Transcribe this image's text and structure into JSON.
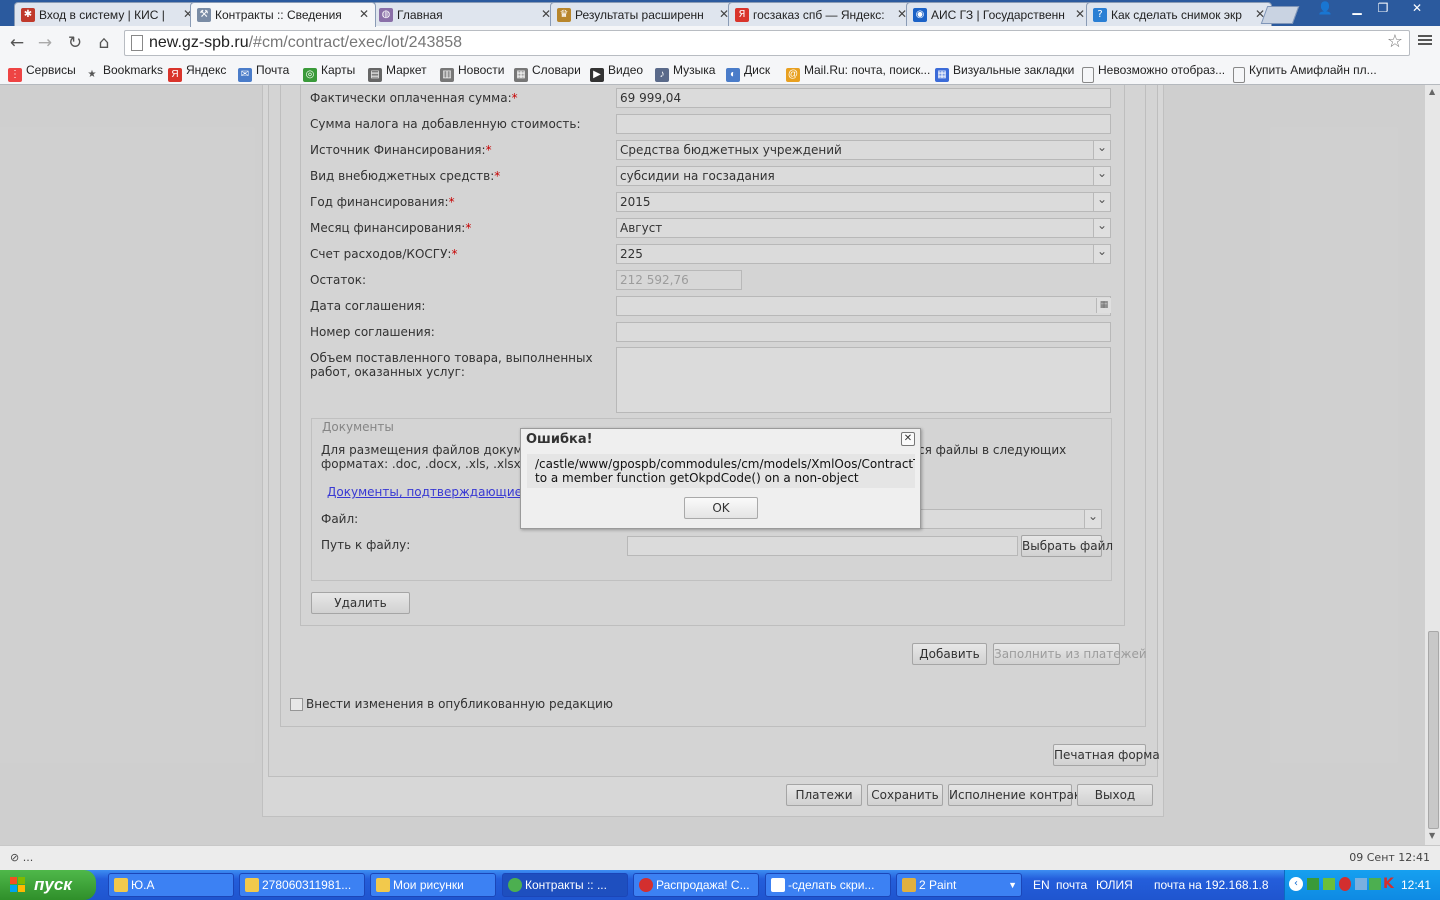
{
  "browser": {
    "tabs": [
      {
        "title": "Вход в систему | КИС |",
        "icon_color": "#c0392b"
      },
      {
        "title": "Контракты :: Сведения",
        "icon_color": "#7a8ca5"
      },
      {
        "title": "Главная",
        "icon_color": "#8a6fa8"
      },
      {
        "title": "Результаты расширенн",
        "icon_color": "#b8862b"
      },
      {
        "title": "госзаказ спб — Яндекс:",
        "icon_color": "#d9342b"
      },
      {
        "title": "АИС ГЗ | Государственн",
        "icon_color": "#1b62c7"
      },
      {
        "title": "Как сделать снимок экр",
        "icon_color": "#2a7fd4"
      }
    ],
    "url_host": "new.gz-spb.ru",
    "url_path": "/#cm/contract/exec/lot/243858",
    "bookmarks": [
      "Сервисы",
      "Bookmarks",
      "Яндекс",
      "Почта",
      "Карты",
      "Маркет",
      "Новости",
      "Словари",
      "Видео",
      "Музыка",
      "Диск",
      "Mail.Ru: почта, поиск...",
      "Визуальные закладки",
      "Невозможно отобраз...",
      "Купить Амифлайн пл..."
    ]
  },
  "form": {
    "rows": [
      {
        "label": "Фактически оплаченная сумма:",
        "required": true,
        "value": "69 999,04",
        "type": "text"
      },
      {
        "label": "Сумма налога на добавленную стоимость:",
        "required": false,
        "value": "",
        "type": "text"
      },
      {
        "label": "Источник Финансирования:",
        "required": true,
        "value": "Средства бюджетных учреждений",
        "type": "select"
      },
      {
        "label": "Вид внебюджетных средств:",
        "required": true,
        "value": "субсидии на госзадания",
        "type": "select"
      },
      {
        "label": "Год финансирования:",
        "required": true,
        "value": "2015",
        "type": "select"
      },
      {
        "label": "Месяц финансирования:",
        "required": true,
        "value": "Август",
        "type": "select"
      },
      {
        "label": "Счет расходов/КОСГУ:",
        "required": true,
        "value": "225",
        "type": "select"
      },
      {
        "label": "Остаток:",
        "required": false,
        "value": "212 592,76",
        "type": "readonly"
      },
      {
        "label": "Дата соглашения:",
        "required": false,
        "value": "",
        "type": "date"
      },
      {
        "label": "Номер соглашения:",
        "required": false,
        "value": "",
        "type": "text"
      }
    ],
    "volume_label": "Объем поставленного товара, выполненных работ, оказанных услуг:",
    "documents": {
      "legend": "Документы",
      "hint_left": "Для размещения файлов документ",
      "hint_right": "ся файлы в следующих",
      "hint_line2": "форматах: .doc, .docx, .xls, .xlsx, .t",
      "link": "Документы, подтверждающие исп",
      "file_label": "Файл:",
      "path_label": "Путь к файлу:",
      "choose_file": "Выбрать файл"
    },
    "delete_button": "Удалить",
    "add_button": "Добавить",
    "fill_from_payments": "Заполнить из платежей",
    "publish_checkbox": "Внести изменения в опубликованную редакцию",
    "print_form": "Печатная форма",
    "bottom_buttons": [
      "Платежи",
      "Сохранить",
      "Исполнение контракта",
      "Выход"
    ]
  },
  "dialog": {
    "title": "Ошибка!",
    "message_line1": "/castle/www/gpospb/commodules/cm/models/XmlOos/ContractTrans",
    "message_line2": "to a member function getOkpdCode() on a non-object",
    "ok": "OK"
  },
  "statusbar": {
    "left": "⊘ ...",
    "right": "09 Сент 12:41"
  },
  "taskbar": {
    "start": "пуск",
    "tasks": [
      {
        "label": "Ю.А",
        "icon_color": "#f2c94c"
      },
      {
        "label": "278060311981...",
        "icon_color": "#f2c94c"
      },
      {
        "label": "Мои рисунки",
        "icon_color": "#f2c94c"
      },
      {
        "label": "Контракты :: ...",
        "icon_color": "#4caf50"
      },
      {
        "label": "Распродажа! С...",
        "icon_color": "#d32f2f"
      },
      {
        "label": "-сделать скри...",
        "icon_color": "#ffffff"
      },
      {
        "label": "2 Paint",
        "icon_color": "#e0b040"
      }
    ],
    "lang": "EN",
    "tray_items": [
      "почта",
      "ЮЛИЯ",
      "почта на 192.168.1.8"
    ],
    "clock": "12:41"
  }
}
